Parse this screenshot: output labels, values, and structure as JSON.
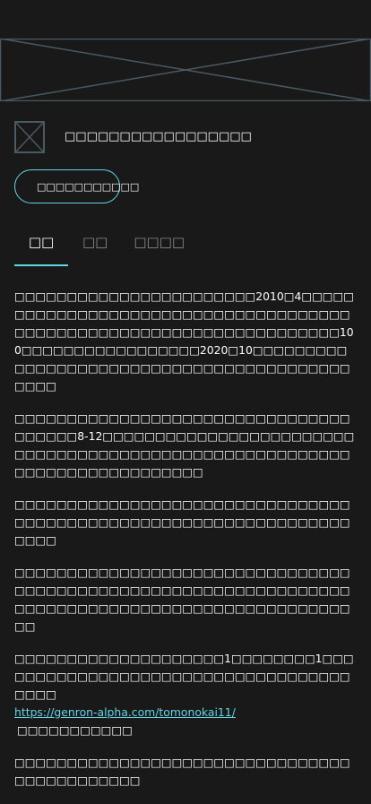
{
  "profile": {
    "name": "□□□□□□□□□□□□□□□□□",
    "badge_label": "□□□□□□□□□□□"
  },
  "tabs": [
    {
      "label": "□□"
    },
    {
      "label": "□□"
    },
    {
      "label": "□□□□"
    }
  ],
  "content": {
    "paragraphs": [
      "□□□□□□□□□□□□□□□□□□□□□□□2010□4□□□□□□□□□□□□□□□□□□□□□□□□□□□□□□□□□□□□□□□□□□□□□□□□□□□□□□□□□□□□□□□□□□□□100□□□□□□□□□□□□□□□□□2020□10□□□□□□□□□□□□□□□□□□□□□□□□□□□□□□□□□□□□□□□□□□□□□",
      "□□□□□□□□□□□□□□□□□□□□□□□□□□□□□□□□□□□□□□8-12□□□□□□□□□□□□□□□□□□□□□□□□□□□□□□□□□□□□□□□□□□□□□□□□□□□□□□□□□□□□□□□□□□□□□□□□□□",
      "□□□□□□□□□□□□□□□□□□□□□□□□□□□□□□□□□□□□□□□□□□□□□□□□□□□□□□□□□□□□□□□□□□□□",
      "□□□□□□□□□□□□□□□□□□□□□□□□□□□□□□□□□□□□□□□□□□□□□□□□□□□□□□□□□□□□□□□□□□□□□□□□□□□□□□□□□□□□□□□□□□□□□□□□□□",
      "□□□□□□□□□□□□□□□□□□□□1□□□□□□□□1□□□□□□□□□□□□□□□□□□□□□□□□□□□□□□□□□□□□□□□"
    ],
    "link": "https://genron-alpha.com/tomonokai11/",
    "after_link": "□□□□□□□□□□□",
    "last_paragraph": "□□□□□□□□□□□□□□□□□□□□□□□□□□□□□□□□□□□□□□□□□□□□"
  },
  "colors": {
    "background": "#191919",
    "accent": "#5fd6e6",
    "placeholder_stroke": "#4a5a62"
  },
  "icons": {
    "banner": "image-placeholder-icon",
    "avatar": "image-placeholder-icon",
    "badge": "check-circle-icon"
  }
}
